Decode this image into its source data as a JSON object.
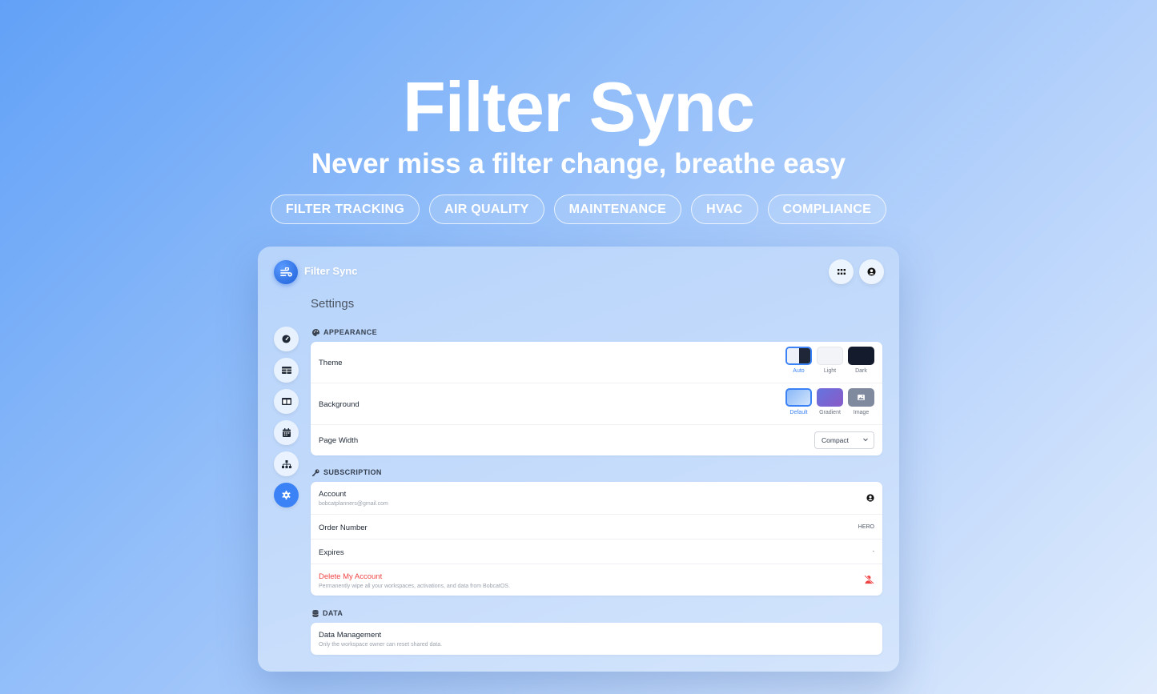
{
  "hero": {
    "title": "Filter Sync",
    "subtitle": "Never miss a filter change, breathe easy",
    "tags": [
      "FILTER TRACKING",
      "AIR QUALITY",
      "MAINTENANCE",
      "HVAC",
      "COMPLIANCE"
    ]
  },
  "app": {
    "name": "Filter Sync",
    "page_title": "Settings",
    "accent": "#3b82f6",
    "top_icons": [
      "apps-grid-icon",
      "user-circle-icon"
    ],
    "sidebar": [
      {
        "icon": "dashboard-gauge-icon",
        "active": false
      },
      {
        "icon": "table-icon",
        "active": false
      },
      {
        "icon": "columns-icon",
        "active": false
      },
      {
        "icon": "calendar-icon",
        "active": false
      },
      {
        "icon": "hierarchy-icon",
        "active": false
      },
      {
        "icon": "gear-icon",
        "active": true
      }
    ],
    "appearance": {
      "label": "APPEARANCE",
      "theme": {
        "label": "Theme",
        "options": [
          {
            "label": "Auto",
            "selected": true
          },
          {
            "label": "Light",
            "selected": false
          },
          {
            "label": "Dark",
            "selected": false
          }
        ]
      },
      "background": {
        "label": "Background",
        "options": [
          {
            "label": "Default",
            "selected": true
          },
          {
            "label": "Gradient",
            "selected": false
          },
          {
            "label": "Image",
            "selected": false
          }
        ]
      },
      "page_width": {
        "label": "Page Width",
        "value": "Compact"
      }
    },
    "subscription": {
      "label": "SUBSCRIPTION",
      "account": {
        "label": "Account",
        "email": "bobcatplanners@gmail.com"
      },
      "order": {
        "label": "Order Number",
        "value": "HERO"
      },
      "expires": {
        "label": "Expires",
        "value": "-"
      },
      "delete": {
        "label": "Delete My Account",
        "desc": "Permanently wipe all your workspaces, activations, and data from BobcatOS.",
        "color": "#ef4444"
      }
    },
    "data": {
      "label": "DATA",
      "management": {
        "label": "Data Management",
        "desc": "Only the workspace owner can reset shared data."
      }
    }
  }
}
